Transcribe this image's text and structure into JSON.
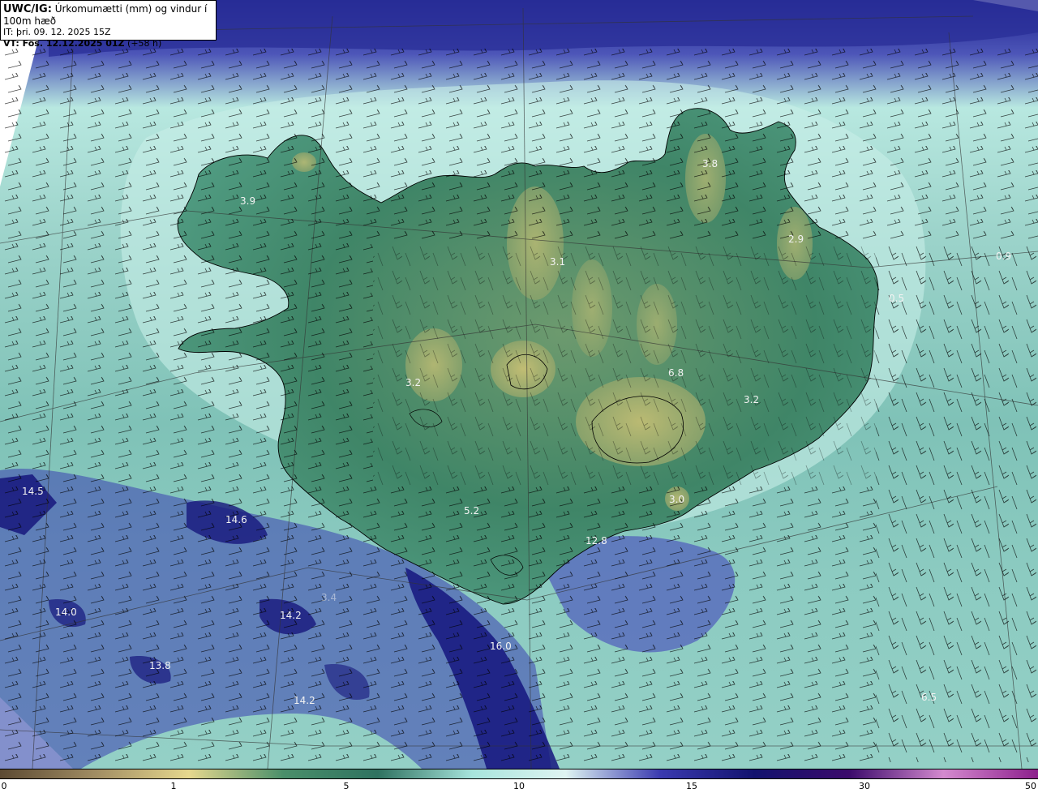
{
  "header": {
    "model_label": "UWC/IG:",
    "title": "Úrkomumætti (mm) og vindur í 100m hæð",
    "init_time": "IT: þri. 09. 12. 2025 15Z",
    "valid_label": "VT: Fös. 12.12.2025 01Z",
    "lead_time": "(+58 h)"
  },
  "map": {
    "labels": [
      {
        "id": "v1",
        "text": "3.9"
      },
      {
        "id": "v2",
        "text": "3.8"
      },
      {
        "id": "v3",
        "text": "2.9"
      },
      {
        "id": "v4",
        "text": "3.1"
      },
      {
        "id": "v5",
        "text": "0.9"
      },
      {
        "id": "v6",
        "text": "0.5"
      },
      {
        "id": "v7",
        "text": "6.8"
      },
      {
        "id": "v8",
        "text": "3.2"
      },
      {
        "id": "v9",
        "text": "3.2"
      },
      {
        "id": "v10",
        "text": "3.0"
      },
      {
        "id": "v11",
        "text": "5.2"
      },
      {
        "id": "v12",
        "text": "12.8"
      },
      {
        "id": "v13",
        "text": "14.5"
      },
      {
        "id": "v14",
        "text": "14.6"
      },
      {
        "id": "v15",
        "text": "14.0"
      },
      {
        "id": "v16",
        "text": "14.2"
      },
      {
        "id": "v17",
        "text": "16.0"
      },
      {
        "id": "v18",
        "text": "13.8"
      },
      {
        "id": "v19",
        "text": "14.2"
      },
      {
        "id": "v20",
        "text": "6.5"
      },
      {
        "id": "v21",
        "text": "3.4"
      }
    ],
    "colors": {
      "land_low": "#3e8466",
      "land_high": "#b6b46a",
      "sea_light": "#a8dcd6",
      "sea_mid": "#6fb8ae",
      "sea_high": "#2e2f9e",
      "sea_dark": "#14147c",
      "coastline": "#000000",
      "barb": "#000000"
    }
  },
  "legend": {
    "ticks": [
      "0",
      "1",
      "5",
      "10",
      "15",
      "30",
      "50"
    ],
    "colors": [
      "#5c4a33",
      "#a08c62",
      "#e6d88e",
      "#4a8f6a",
      "#2f7260",
      "#a7e4dc",
      "#dff4f2",
      "#3a3ab0",
      "#12126e",
      "#3b0a6b",
      "#d48acf",
      "#8c1f8c"
    ]
  }
}
